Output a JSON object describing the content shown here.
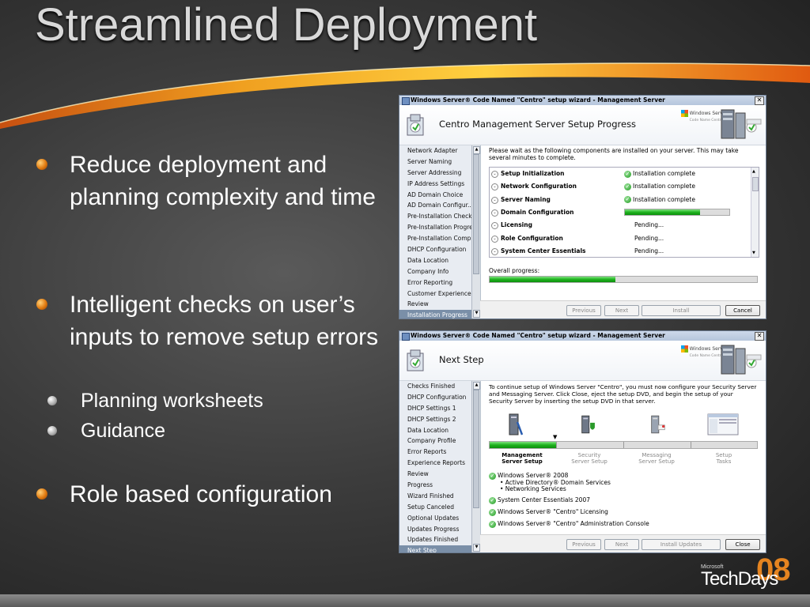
{
  "slide": {
    "title": "Streamlined Deployment",
    "bullets": [
      {
        "text": "Reduce deployment and planning complexity and time"
      },
      {
        "text": "Intelligent checks on user’s inputs to remove setup errors",
        "sub": [
          "Planning worksheets",
          "Guidance"
        ]
      },
      {
        "text": "Role based configuration"
      }
    ],
    "logo": {
      "small": "Microsoft",
      "main": "TechDays",
      "num": "08"
    }
  },
  "window1": {
    "title": "Windows Server® Code Named \"Centro\" setup wizard - Management Server",
    "close": "✕",
    "header": "Centro Management Server Setup Progress",
    "brand_line1": "Windows Server",
    "brand_line2": "Code Name Centro",
    "nav": [
      "Network Adapter",
      "Server Naming",
      "Server Addressing",
      "IP Address Settings",
      "AD Domain Choice",
      "AD Domain Configur...",
      "Pre-Installation Checks",
      "Pre-Installation Progress",
      "Pre-Installation Complet",
      "DHCP Configuration",
      "Data Location",
      "Company Info",
      "Error Reporting",
      "Customer Experience",
      "Review",
      "Installation Progress"
    ],
    "nav_active": "Installation Progress",
    "intro": "Please wait as the following components are installed on your server. This may take several minutes to complete.",
    "components": [
      {
        "name": "Setup Initialization",
        "status": "Installation complete",
        "done": true
      },
      {
        "name": "Network Configuration",
        "status": "Installation complete",
        "done": true
      },
      {
        "name": "Server Naming",
        "status": "Installation complete",
        "done": true
      },
      {
        "name": "Domain Configuration",
        "status": "",
        "progress": 0.72
      },
      {
        "name": "Licensing",
        "status": "Pending...",
        "done": false
      },
      {
        "name": "Role Configuration",
        "status": "Pending...",
        "done": false
      },
      {
        "name": "System Center Essentials",
        "status": "Pending...",
        "done": false
      }
    ],
    "overall_label": "Overall progress:",
    "overall_progress": 0.47,
    "buttons": {
      "previous": "Previous",
      "next": "Next",
      "install": "Install",
      "cancel": "Cancel"
    }
  },
  "window2": {
    "title": "Windows Server® Code Named \"Centro\" setup wizard - Management Server",
    "close": "✕",
    "header": "Next Step",
    "brand_line1": "Windows Server",
    "brand_line2": "Code Name Centro",
    "nav": [
      "Checks Finished",
      "DHCP Configuration",
      "DHCP Settings 1",
      "DHCP Settings 2",
      "Data Location",
      "Company Profile",
      "Error Reports",
      "Experience Reports",
      "Review",
      "Progress",
      "Wizard Finished",
      "Setup Canceled",
      "Optional Updates",
      "Updates Progress",
      "Updates Finished",
      "Next Step"
    ],
    "nav_active": "Next Step",
    "intro": "To continue setup of Windows Server \"Centro\", you must now configure your Security Server and Messaging Server. Click Close, eject the setup DVD, and begin the setup of your Security Server by inserting the setup DVD in that server.",
    "steps": [
      {
        "line1": "Management",
        "line2": "Server Setup",
        "done": true
      },
      {
        "line1": "Security",
        "line2": "Server Setup",
        "done": false
      },
      {
        "line1": "Messaging",
        "line2": "Server Setup",
        "done": false
      },
      {
        "line1": "Setup",
        "line2": "Tasks",
        "done": false
      }
    ],
    "installed": [
      {
        "text": "Windows Server® 2008",
        "subs": [
          "• Active Directory® Domain Services",
          "• Networking Services"
        ]
      },
      {
        "text": "System Center Essentials 2007",
        "subs": []
      },
      {
        "text": "Windows Server® \"Centro\" Licensing",
        "subs": []
      },
      {
        "text": "Windows Server® \"Centro\" Administration Console",
        "subs": []
      }
    ],
    "buttons": {
      "previous": "Previous",
      "next": "Next",
      "install_updates": "Install Updates",
      "close": "Close"
    }
  },
  "colors": {
    "accent_orange": "#f0a020",
    "progress_green": "#1fb31f",
    "nav_active": "#7a8fa8"
  }
}
